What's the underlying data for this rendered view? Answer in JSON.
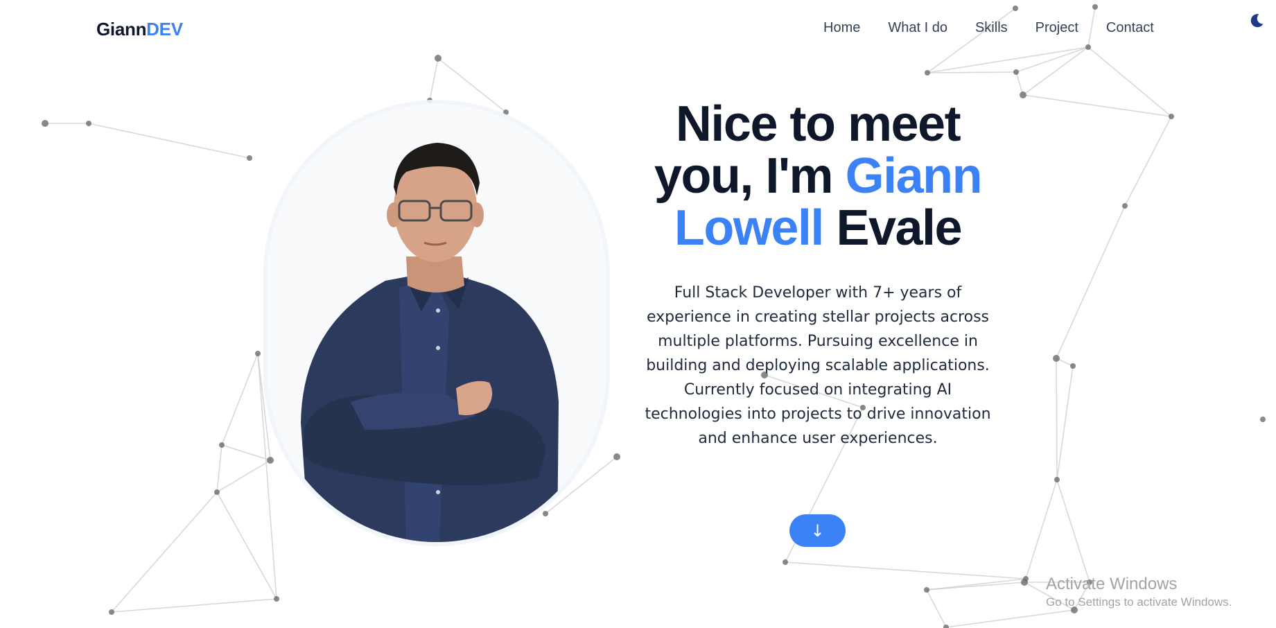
{
  "brand": {
    "name_part1": "Giann",
    "name_part2": "DEV"
  },
  "nav": {
    "items": [
      {
        "label": "Home"
      },
      {
        "label": "What I do"
      },
      {
        "label": "Skills"
      },
      {
        "label": "Project"
      },
      {
        "label": "Contact"
      }
    ],
    "theme_toggle_icon": "moon-icon"
  },
  "hero": {
    "heading_line1": "Nice to meet",
    "heading_prefix": "you, I'm",
    "heading_highlight_first": "Giann",
    "heading_highlight_second": "Lowell",
    "heading_suffix": "Evale",
    "description": "Full Stack Developer with 7+ years of experience in creating stellar projects across multiple platforms. Pursuing excellence in building and deploying scalable applications. Currently focused on integrating AI technologies into projects to drive innovation and enhance user experiences.",
    "scroll_button_icon": "arrow-down-icon",
    "scroll_button_glyph": "↓"
  },
  "portrait": {
    "icon": "profile-photo"
  },
  "watermark": {
    "title": "Activate Windows",
    "subtitle": "Go to Settings to activate Windows."
  },
  "colors": {
    "accent": "#3b82f6",
    "heading": "#0f172a",
    "body_text": "#1e293b",
    "nav_text": "#334155",
    "moon": "#1e3a8a",
    "network_line": "#c8c8c8",
    "network_node": "#6b6b6b"
  }
}
